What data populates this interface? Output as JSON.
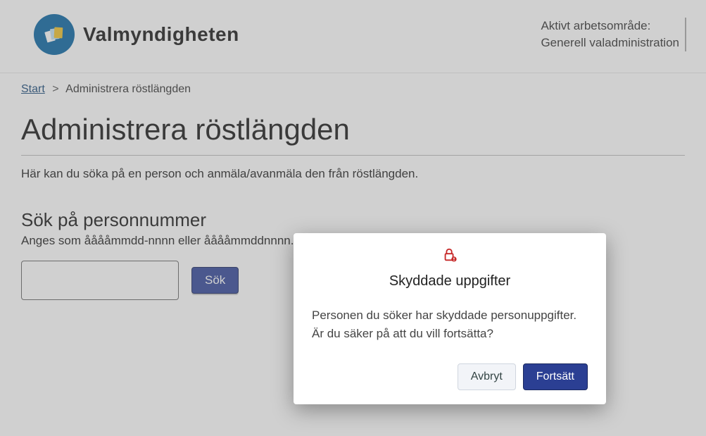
{
  "header": {
    "logo_text": "Valmyndigheten",
    "workspace_label": "Aktivt arbetsområde:",
    "workspace_value": "Generell valadministration"
  },
  "breadcrumb": {
    "start": "Start",
    "current": "Administrera röstlängden"
  },
  "main": {
    "title": "Administrera röstlängden",
    "intro": "Här kan du söka på en person och anmäla/avanmäla den från röstlängden.",
    "search_heading": "Sök på personnummer",
    "hint": "Anges som ååååmmdd-nnnn eller ååååmmddnnnn.",
    "search_button": "Sök",
    "search_value": ""
  },
  "modal": {
    "title": "Skyddade uppgifter",
    "body_line1": "Personen du söker har skyddade personuppgifter.",
    "body_line2": "Är du säker på att du vill fortsätta?",
    "cancel": "Avbryt",
    "continue": "Fortsätt"
  }
}
